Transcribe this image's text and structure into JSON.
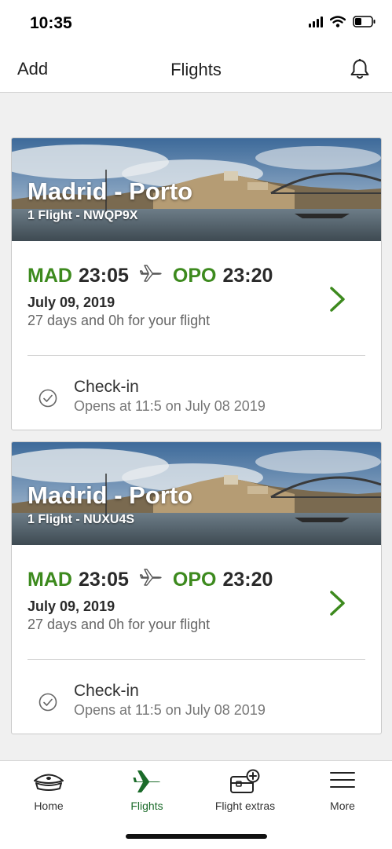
{
  "status_bar": {
    "time": "10:35"
  },
  "nav": {
    "left_label": "Add",
    "title": "Flights",
    "bell_icon": "bell-icon"
  },
  "colors": {
    "accent_green": "#3d8a1e",
    "tab_active": "#1b6b2a"
  },
  "bookings": [
    {
      "route_title": "Madrid - Porto",
      "subtitle": "1 Flight - NWQP9X",
      "origin_code": "MAD",
      "departure_time": "23:05",
      "destination_code": "OPO",
      "arrival_time": "23:20",
      "date": "July 09, 2019",
      "countdown": "27 days and 0h for your flight",
      "checkin_title": "Check-in",
      "checkin_subtitle": "Opens at 11:5 on July 08 2019"
    },
    {
      "route_title": "Madrid - Porto",
      "subtitle": "1 Flight - NUXU4S",
      "origin_code": "MAD",
      "departure_time": "23:05",
      "destination_code": "OPO",
      "arrival_time": "23:20",
      "date": "July 09, 2019",
      "countdown": "27 days and 0h for your flight",
      "checkin_title": "Check-in",
      "checkin_subtitle": "Opens at 11:5 on July 08 2019"
    }
  ],
  "tab_bar": {
    "items": [
      {
        "label": "Home",
        "icon": "captain-hat-icon",
        "active": false
      },
      {
        "label": "Flights",
        "icon": "airplane-icon",
        "active": true
      },
      {
        "label": "Flight extras",
        "icon": "luggage-plus-icon",
        "active": false
      },
      {
        "label": "More",
        "icon": "menu-icon",
        "active": false
      }
    ]
  }
}
